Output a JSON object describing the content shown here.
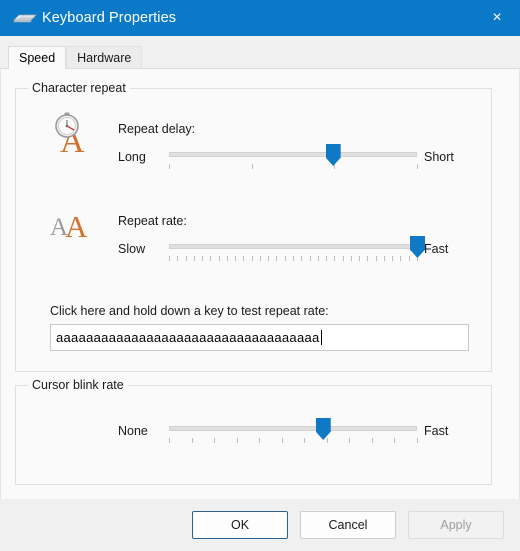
{
  "window": {
    "title": "Keyboard Properties",
    "icon": "keyboard-icon",
    "close_label": "×",
    "accent_color": "#0a7ac8",
    "background_color": "#f0f0f0"
  },
  "tabs": [
    {
      "label": "Speed",
      "selected": true
    },
    {
      "label": "Hardware",
      "selected": false
    }
  ],
  "character_repeat": {
    "title": "Character repeat",
    "repeat_delay": {
      "icon": "stopwatch-letter-a-icon",
      "caption": "Repeat delay:",
      "min_label": "Long",
      "max_label": "Short",
      "value_percent": 66,
      "tick_count": 4,
      "thumb_color": "#1079c5"
    },
    "repeat_rate": {
      "icon": "double-letter-a-icon",
      "caption": "Repeat rate:",
      "min_label": "Slow",
      "max_label": "Fast",
      "value_percent": 100,
      "tick_count": 31,
      "thumb_color": "#1079c5"
    },
    "test_field": {
      "label": "Click here and hold down a key to test repeat rate:",
      "value": "aaaaaaaaaaaaaaaaaaaaaaaaaaaaaaaaaaa",
      "placeholder": ""
    }
  },
  "cursor_blink_rate": {
    "title": "Cursor blink rate",
    "slider": {
      "min_label": "None",
      "max_label": "Fast",
      "value_percent": 62,
      "tick_count": 12,
      "thumb_color": "#1079c5"
    }
  },
  "footer": {
    "ok_label": "OK",
    "cancel_label": "Cancel",
    "apply_label": "Apply",
    "apply_enabled": false
  }
}
